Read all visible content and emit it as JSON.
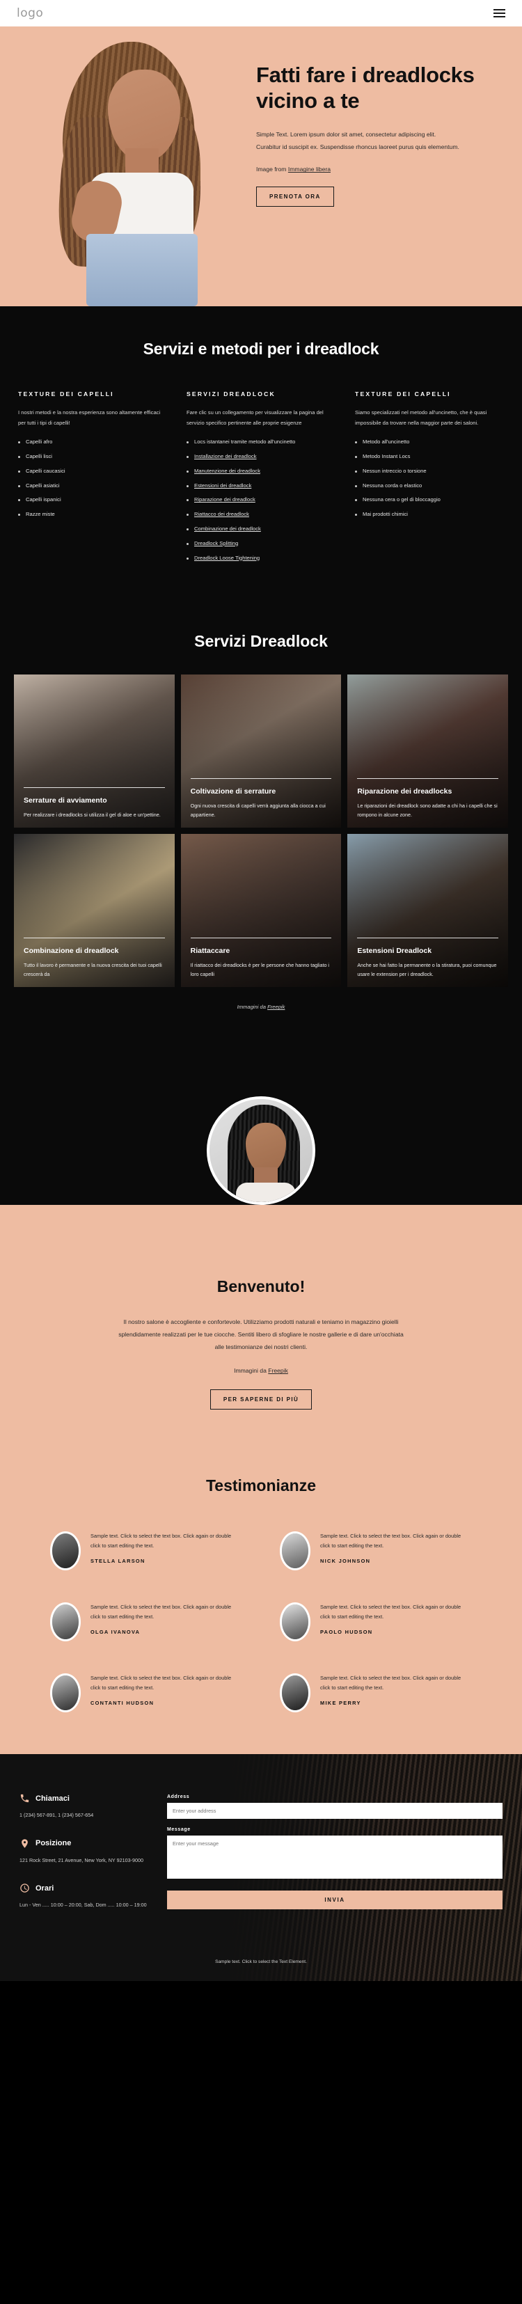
{
  "header": {
    "logo": "logo",
    "menu_icon": "hamburger-menu-icon"
  },
  "hero": {
    "title": "Fatti fare i dreadlocks vicino a te",
    "paragraph": "Simple Text. Lorem ipsum dolor sit amet, consectetur adipiscing elit. Curabitur id suscipit ex. Suspendisse rhoncus laoreet purus quis elementum.",
    "credit_prefix": "Image from ",
    "credit_link": "Immagine libera",
    "cta": "PRENOTA ORA",
    "bg_color": "#eebca2"
  },
  "services": {
    "title": "Servizi e metodi per i dreadlock",
    "columns": [
      {
        "heading": "TEXTURE DEI CAPELLI",
        "paragraph": "I nostri metodi e la nostra esperienza sono altamente efficaci per tutti i tipi di capelli!",
        "items": [
          {
            "label": "Capelli afro",
            "link": false
          },
          {
            "label": "Capelli lisci",
            "link": false
          },
          {
            "label": "Capelli caucasici",
            "link": false
          },
          {
            "label": "Capelli asiatici",
            "link": false
          },
          {
            "label": "Capelli ispanici",
            "link": false
          },
          {
            "label": "Razze miste",
            "link": false
          }
        ]
      },
      {
        "heading": "SERVIZI DREADLOCK",
        "paragraph": "Fare clic su un collegamento per visualizzare la pagina del servizio specifico pertinente alle proprie esigenze",
        "items": [
          {
            "label": "Locs istantanei tramite metodo all'uncinetto",
            "link": false
          },
          {
            "label": "Installazione dei dreadlock",
            "link": true
          },
          {
            "label": "Manutenzione dei dreadlock",
            "link": true
          },
          {
            "label": "Estensioni dei dreadlock",
            "link": true
          },
          {
            "label": "Riparazione dei dreadlock",
            "link": true
          },
          {
            "label": "Riattacco dei dreadlock",
            "link": true
          },
          {
            "label": "Combinazione dei dreadlock",
            "link": true
          },
          {
            "label": "Dreadlock Splitting",
            "link": true
          },
          {
            "label": "Dreadlock Loose Tightening",
            "link": true
          }
        ]
      },
      {
        "heading": "TEXTURE DEI CAPELLI",
        "paragraph": "Siamo specializzati nel metodo all'uncinetto, che è quasi impossibile da trovare nella maggior parte dei saloni.",
        "items": [
          {
            "label": "Metodo all'uncinetto",
            "link": false
          },
          {
            "label": "Metodo Instant Locs",
            "link": false
          },
          {
            "label": "Nessun intreccio o torsione",
            "link": false
          },
          {
            "label": "Nessuna corda o elastico",
            "link": false
          },
          {
            "label": "Nessuna cera o gel di bloccaggio",
            "link": false
          },
          {
            "label": "Mai prodotti chimici",
            "link": false
          }
        ]
      }
    ]
  },
  "gallery": {
    "title": "Servizi Dreadlock",
    "credit_prefix": "Immagini da ",
    "credit_link": "Freepik",
    "cards": [
      {
        "title": "Serrature di avviamento",
        "text": "Per realizzare i dreadlocks si utilizza il gel di aloe e un'pettine."
      },
      {
        "title": "Coltivazione di serrature",
        "text": "Ogni nuova crescita di capelli verrà aggiunta alla ciocca a cui appartiene."
      },
      {
        "title": "Riparazione dei dreadlocks",
        "text": "Le riparazioni dei dreadlock sono adatte a chi ha i capelli che si rompono in alcune zone."
      },
      {
        "title": "Combinazione di dreadlock",
        "text": "Tutto il lavoro è permanente e la nuova crescita dei tuoi capelli crescerà da"
      },
      {
        "title": "Riattaccare",
        "text": "Il riattacco dei dreadlocks è per le persone che hanno tagliato i loro capelli"
      },
      {
        "title": "Estensioni Dreadlock",
        "text": "Anche se hai fatto la permanente o la stiratura, puoi comunque usare le extension per i dreadlock."
      }
    ]
  },
  "welcome": {
    "avatar": "portrait-avatar",
    "title": "Benvenuto!",
    "paragraph": "Il nostro salone è accogliente e confortevole. Utilizziamo prodotti naturali e teniamo in magazzino gioielli splendidamente realizzati per le tue ciocche. Sentiti libero di sfogliare le nostre gallerie e di dare un'occhiata alle testimonianze dei nostri clienti.",
    "credit_prefix": "Immagini da ",
    "credit_link": "Freepik",
    "cta": "PER SAPERNE DI PIÙ"
  },
  "testimonials": {
    "title": "Testimonianze",
    "items": [
      {
        "text": "Sample text. Click to select the text box. Click again or double click to start editing the text.",
        "name": "STELLA LARSON"
      },
      {
        "text": "Sample text. Click to select the text box. Click again or double click to start editing the text.",
        "name": "NICK JOHNSON"
      },
      {
        "text": "Sample text. Click to select the text box. Click again or double click to start editing the text.",
        "name": "OLGA IVANOVA"
      },
      {
        "text": "Sample text. Click to select the text box. Click again or double click to start editing the text.",
        "name": "PAOLO HUDSON"
      },
      {
        "text": "Sample text. Click to select the text box. Click again or double click to start editing the text.",
        "name": "CONTANTI HUDSON"
      },
      {
        "text": "Sample text. Click to select the text box. Click again or double click to start editing the text.",
        "name": "MIKE PERRY"
      }
    ]
  },
  "footer": {
    "contact": {
      "icon": "phone-icon",
      "title": "Chiamaci",
      "body": "1 (234) 567-891, 1 (234) 567-654"
    },
    "position": {
      "icon": "map-pin-icon",
      "title": "Posizione",
      "body": "121 Rock Street, 21 Avenue, New York, NY 92103-9000"
    },
    "hours": {
      "icon": "clock-icon",
      "title": "Orari",
      "body": "Lun - Ven ..... 10:00 – 20:00, Sab, Dom ..... 10:00 – 19:00"
    },
    "form": {
      "address_label": "Address",
      "address_placeholder": "Enter your address",
      "message_label": "Message",
      "message_placeholder": "Enter your message",
      "submit": "INVIA"
    },
    "bottom_note": "Sample text. Click to select the Text Element.",
    "accent": "#eebca2"
  }
}
